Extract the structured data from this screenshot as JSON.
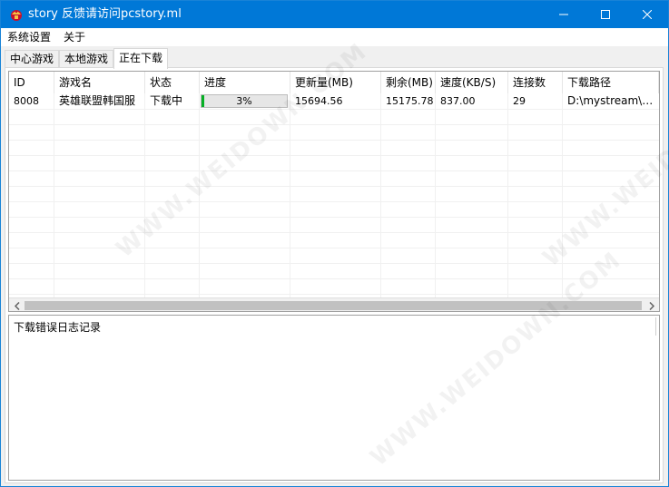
{
  "window": {
    "title": "story 反馈请访问pcstory.ml"
  },
  "menu": [
    {
      "label": "系统设置"
    },
    {
      "label": "关于"
    }
  ],
  "tabs": [
    {
      "label": "中心游戏",
      "active": false
    },
    {
      "label": "本地游戏",
      "active": false
    },
    {
      "label": "正在下载",
      "active": true
    }
  ],
  "table": {
    "columns": [
      "ID",
      "游戏名",
      "状态",
      "进度",
      "更新量(MB)",
      "剩余(MB)",
      "速度(KB/S)",
      "连接数",
      "下载路径"
    ],
    "rows": [
      {
        "id": "8008",
        "name": "英雄联盟韩国服",
        "status": "下载中",
        "progress_text": "3%",
        "progress": 0.03,
        "update_mb": "15694.56",
        "remaining_mb": "15175.78",
        "speed": "837.00",
        "connections": "29",
        "path": "D:\\mystream\\英雄..."
      }
    ]
  },
  "log": {
    "label": "下载错误日志记录"
  },
  "watermark": "WWW.WEIDOWN.COM",
  "colors": {
    "titlebar": "#0078d7",
    "progress_fill": "#06b025"
  }
}
